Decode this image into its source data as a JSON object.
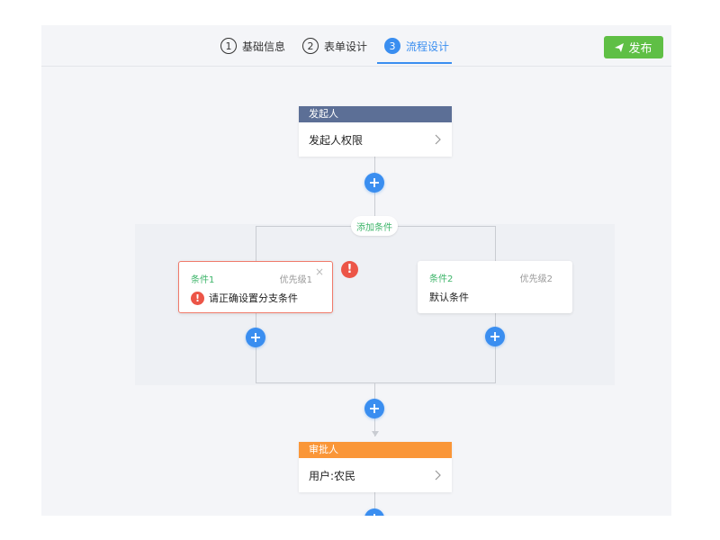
{
  "steps": [
    {
      "num": "1",
      "label": "基础信息"
    },
    {
      "num": "2",
      "label": "表单设计"
    },
    {
      "num": "3",
      "label": "流程设计"
    }
  ],
  "publish_label": "发布",
  "start_node": {
    "header": "发起人",
    "body": "发起人权限",
    "header_color": "#5c6f96"
  },
  "add_condition_label": "添加条件",
  "conditions": [
    {
      "name": "条件1",
      "priority": "优先级1",
      "text": "请正确设置分支条件",
      "error": true
    },
    {
      "name": "条件2",
      "priority": "优先级2",
      "text": "默认条件",
      "error": false
    }
  ],
  "approver_node": {
    "header": "审批人",
    "body": "用户:农民",
    "header_color": "#fa9638"
  },
  "colors": {
    "accent": "#3a8ef0",
    "publish": "#5fbf45",
    "condition_name": "#3eb56a",
    "error": "#ec5547"
  },
  "icons": {
    "error": "!",
    "close": "×"
  }
}
